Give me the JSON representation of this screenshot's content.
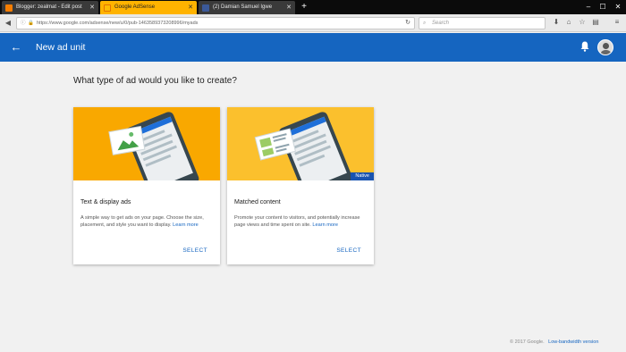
{
  "browser": {
    "tabs": [
      {
        "label": "Blogger: zealmat - Edit post",
        "icon_color": "#f57d00",
        "active": false
      },
      {
        "label": "Google AdSense",
        "icon_color": "#fbbc05",
        "active": true
      },
      {
        "label": "(2) Damian Samuel Igwe",
        "icon_color": "#3b5998",
        "active": false
      }
    ],
    "new_tab_label": "+",
    "url": "https://www.google.com/adsense/new/u/0/pub-1463589373208996/myads",
    "search_placeholder": "Search",
    "window_controls": [
      "minimize-icon",
      "maximize-icon",
      "close-icon"
    ]
  },
  "header": {
    "title": "New ad unit",
    "background": "#1565c0",
    "icons": [
      "arrow-back-icon",
      "bell-icon",
      "avatar"
    ]
  },
  "main": {
    "question": "What type of ad would you like to create?",
    "cards": [
      {
        "title": "Text & display ads",
        "description": "A simple way to get ads on your page. Choose the size, placement, and style you want to display.",
        "learn_more": "Learn more",
        "select_label": "SELECT",
        "illustration_bg": "#f9a800",
        "badge": ""
      },
      {
        "title": "Matched content",
        "description": "Promote your content to visitors, and potentially increase page views and time spent on site.",
        "learn_more": "Learn more",
        "select_label": "SELECT",
        "illustration_bg": "#fbc02d",
        "badge": "Native"
      }
    ]
  },
  "footer": {
    "copyright": "© 2017 Google.",
    "low_bandwidth": "Low-bandwidth version"
  }
}
